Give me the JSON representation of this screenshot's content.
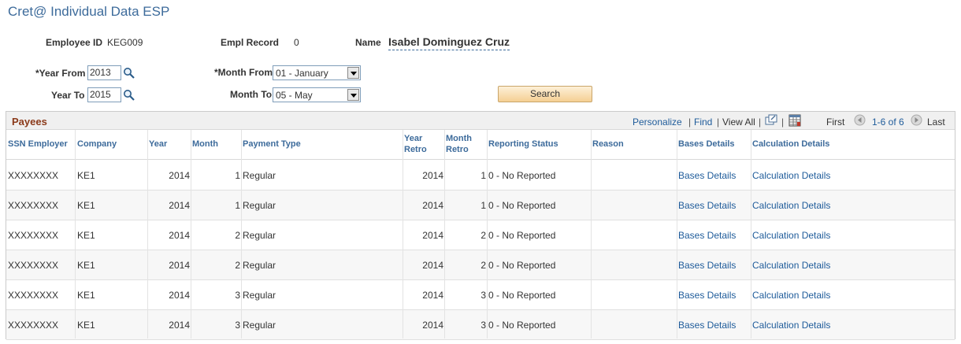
{
  "page": {
    "title": "Cret@ Individual Data ESP"
  },
  "header": {
    "employee_id_label": "Employee ID",
    "employee_id": "KEG009",
    "empl_record_label": "Empl Record",
    "empl_record": "0",
    "name_label": "Name",
    "name": "Isabel Dominguez Cruz"
  },
  "search": {
    "year_from_label": "*Year From",
    "year_from": "2013",
    "year_to_label": "Year To",
    "year_to": "2015",
    "month_from_label": "*Month From",
    "month_from": "01 - January",
    "month_to_label": "Month To",
    "month_to": "05 - May",
    "button_label": "Search"
  },
  "grid": {
    "title": "Payees",
    "personalize": "Personalize",
    "sep": "|",
    "find": "Find",
    "view_all": "View All",
    "first": "First",
    "range": "1-6 of 6",
    "last": "Last",
    "columns": {
      "ssn": "SSN Employer",
      "company": "Company",
      "year": "Year",
      "month": "Month",
      "payment_type": "Payment Type",
      "year_retro_1": "Year",
      "year_retro_2": "Retro",
      "month_retro_1": "Month",
      "month_retro_2": "Retro",
      "reporting_status": "Reporting Status",
      "reason": "Reason",
      "bases_details": "Bases Details",
      "calculation_details": "Calculation Details"
    },
    "rows": [
      {
        "ssn": "XXXXXXXX",
        "company": "KE1",
        "year": "2014",
        "month": "1",
        "payment_type": "Regular",
        "year_retro": "2014",
        "month_retro": "1",
        "status": "0 - No Reported",
        "reason": "",
        "bases": "Bases Details",
        "calc": "Calculation Details"
      },
      {
        "ssn": "XXXXXXXX",
        "company": "KE1",
        "year": "2014",
        "month": "1",
        "payment_type": "Regular",
        "year_retro": "2014",
        "month_retro": "1",
        "status": "0 - No Reported",
        "reason": "",
        "bases": "Bases Details",
        "calc": "Calculation Details"
      },
      {
        "ssn": "XXXXXXXX",
        "company": "KE1",
        "year": "2014",
        "month": "2",
        "payment_type": "Regular",
        "year_retro": "2014",
        "month_retro": "2",
        "status": "0 - No Reported",
        "reason": "",
        "bases": "Bases Details",
        "calc": "Calculation Details"
      },
      {
        "ssn": "XXXXXXXX",
        "company": "KE1",
        "year": "2014",
        "month": "2",
        "payment_type": "Regular",
        "year_retro": "2014",
        "month_retro": "2",
        "status": "0 - No Reported",
        "reason": "",
        "bases": "Bases Details",
        "calc": "Calculation Details"
      },
      {
        "ssn": "XXXXXXXX",
        "company": "KE1",
        "year": "2014",
        "month": "3",
        "payment_type": "Regular",
        "year_retro": "2014",
        "month_retro": "3",
        "status": "0 - No Reported",
        "reason": "",
        "bases": "Bases Details",
        "calc": "Calculation Details"
      },
      {
        "ssn": "XXXXXXXX",
        "company": "KE1",
        "year": "2014",
        "month": "3",
        "payment_type": "Regular",
        "year_retro": "2014",
        "month_retro": "3",
        "status": "0 - No Reported",
        "reason": "",
        "bases": "Bases Details",
        "calc": "Calculation Details"
      }
    ]
  },
  "icons": {
    "lookup": "magnifier-icon",
    "dropdown": "chevron-down-icon",
    "zoom": "new-window-icon",
    "download": "spreadsheet-download-icon",
    "prev": "arrow-left-circle-icon",
    "next": "arrow-right-circle-icon"
  },
  "colors": {
    "title": "#3d6b9b",
    "link": "#1e5b9a",
    "grid_title": "#8b3a1a",
    "button": "#f5cf93"
  }
}
